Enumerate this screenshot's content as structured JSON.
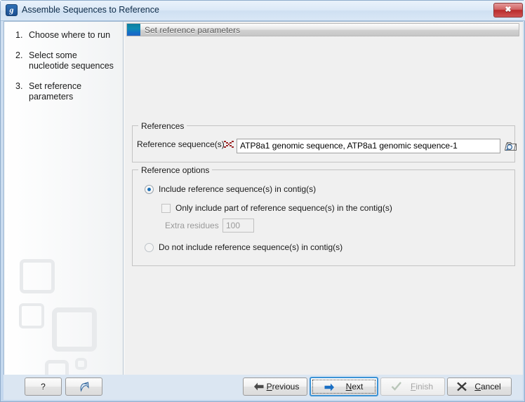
{
  "window": {
    "title": "Assemble Sequences to Reference",
    "app_icon": "g",
    "close_label": "✖"
  },
  "sidebar": {
    "steps": [
      {
        "num": "1.",
        "label": "Choose where to run"
      },
      {
        "num": "2.",
        "label": "Select some nucleotide sequences"
      },
      {
        "num": "3.",
        "label": "Set reference parameters"
      }
    ]
  },
  "panel": {
    "header_title": "Set reference parameters"
  },
  "references_group": {
    "title": "References",
    "reference_sequences_label": "Reference sequence(s)",
    "dna_icon": "dna-icon",
    "reference_sequences_value": "ATP8a1 genomic sequence, ATP8a1 genomic sequence-1",
    "browse_icon": "folder-search-icon"
  },
  "reference_options_group": {
    "title": "Reference options",
    "include_reference_label": "Include reference sequence(s) in contig(s)",
    "include_reference_selected": true,
    "only_part_label": "Only include part of reference sequence(s) in the contig(s)",
    "only_part_checked": false,
    "extra_residues_label": "Extra residues",
    "extra_residues_value": "100",
    "do_not_include_label": "Do not include reference sequence(s) in contig(s)",
    "do_not_include_selected": false
  },
  "bottom_bar": {
    "help_label": "?",
    "reset_icon": "reset-arrow-icon",
    "previous": {
      "label": "Previous",
      "mnemonic": "P",
      "icon": "arrow-left-icon"
    },
    "next": {
      "label": "Next",
      "mnemonic": "N",
      "icon": "arrow-right-icon",
      "focused": true
    },
    "finish": {
      "label": "Finish",
      "mnemonic": "F",
      "icon": "check-icon",
      "disabled": true
    },
    "cancel": {
      "label": "Cancel",
      "mnemonic": "C",
      "icon": "close-x-icon"
    }
  },
  "colors": {
    "accent_blue": "#1c6fb5",
    "header_icon_teal": "#0d7e9e",
    "dna_red": "#9e2b2b",
    "focus_blue": "#3c93d6",
    "close_red": "#b92c2c"
  }
}
